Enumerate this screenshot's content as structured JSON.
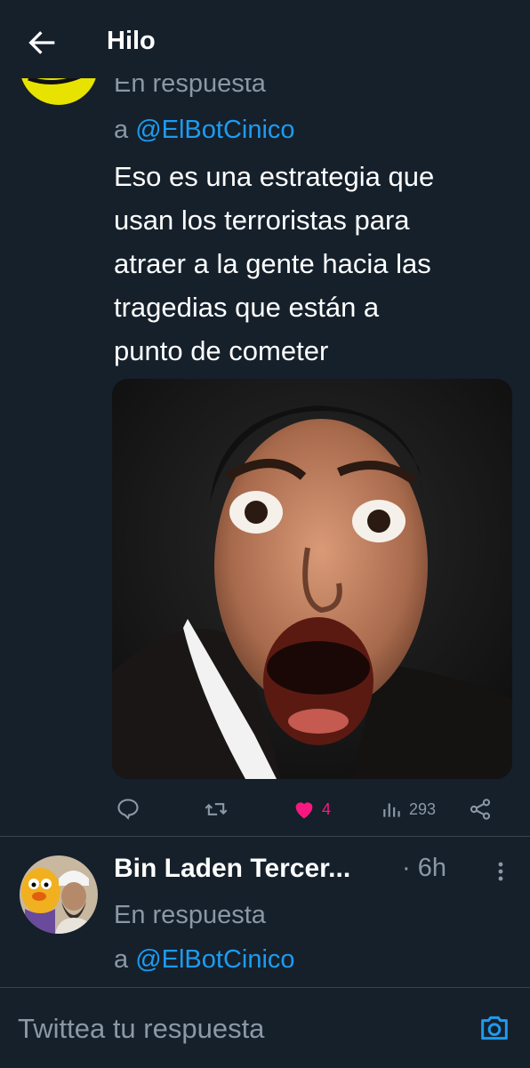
{
  "header": {
    "title": "Hilo",
    "back_icon": "arrow-left-icon"
  },
  "tweet1": {
    "reply_prefix": "En respuesta",
    "reply_to_prefix": "a ",
    "reply_handle": "@ElBotCinico",
    "text_lines": [
      "Eso es una estrategia que",
      "usan los terroristas para",
      "atraer a la gente hacia las",
      "tragedias que están a",
      "punto de cometer"
    ],
    "likes": "4",
    "views": "293",
    "liked": true
  },
  "tweet2": {
    "name": "Bin Laden Tercer...",
    "time": "· 6h",
    "reply_prefix": "En respuesta",
    "reply_to_prefix": "a ",
    "reply_handle": "@ElBotCinico"
  },
  "composer": {
    "placeholder": "Twittea tu respuesta",
    "value": ""
  },
  "colors": {
    "background": "#15202b",
    "accent": "#1d9bf0",
    "like": "#f91880",
    "muted": "#8b98a5",
    "divider": "#38444d"
  }
}
